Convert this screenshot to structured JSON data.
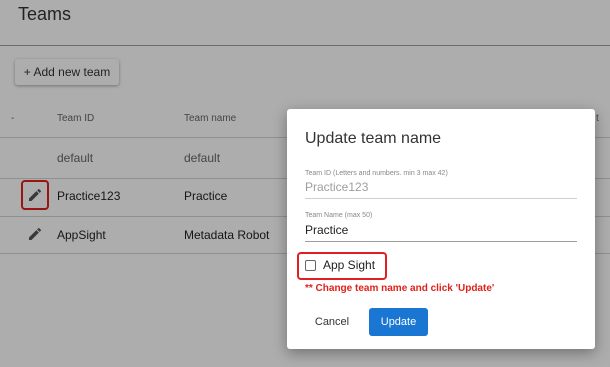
{
  "page": {
    "title": "Teams"
  },
  "toolbar": {
    "add_label": "+ Add new team"
  },
  "table": {
    "headers": {
      "select": "-",
      "id": "Team ID",
      "name": "Team name",
      "extra": "t"
    },
    "rows": [
      {
        "id": "default",
        "name": "default"
      },
      {
        "id": "Practice123",
        "name": "Practice"
      },
      {
        "id": "AppSight",
        "name": "Metadata Robot"
      }
    ]
  },
  "icons": {
    "edit": "pencil-icon",
    "checkbox": "checkbox-unchecked-icon"
  },
  "dialog": {
    "title": "Update team name",
    "team_id_label": "Team ID (Letters and numbers. min 3 max 42)",
    "team_id_value": "Practice123",
    "team_name_label": "Team Name (max 50)",
    "team_name_value": "Practice",
    "checkbox_label": "App Sight",
    "hint": "** Change team name and click 'Update'",
    "cancel_label": "Cancel",
    "update_label": "Update"
  },
  "colors": {
    "primary": "#1976d2",
    "highlight": "#e02020",
    "hint": "#e0201a",
    "overlay": "rgba(0,0,0,0.32)"
  }
}
